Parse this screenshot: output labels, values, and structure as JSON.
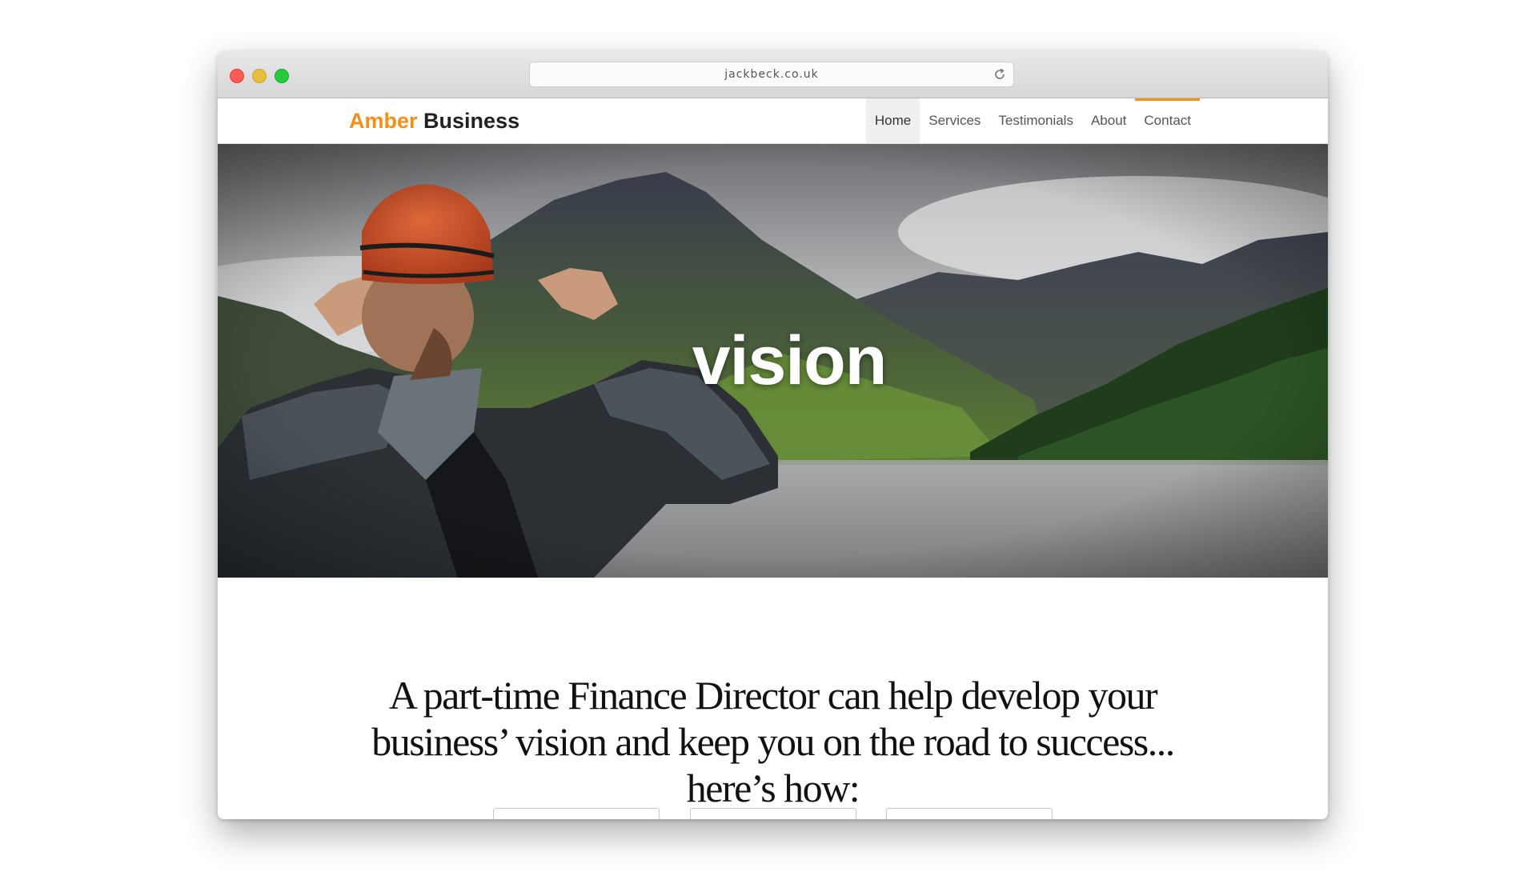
{
  "browser": {
    "url": "jackbeck.co.uk",
    "traffic_lights": [
      "close",
      "minimize",
      "zoom"
    ],
    "reload_icon": "reload-icon"
  },
  "site": {
    "logo_first": "Amber",
    "logo_second": "Business",
    "nav": [
      {
        "label": "Home"
      },
      {
        "label": "Services"
      },
      {
        "label": "Testimonials"
      },
      {
        "label": "About"
      },
      {
        "label": "Contact"
      }
    ]
  },
  "hero": {
    "word": "vision"
  },
  "main": {
    "headline_line1": "A part-time Finance Director can help develop your",
    "headline_line2": "business’ vision and keep you on the road to success...",
    "headline_line3": "here’s how:"
  },
  "colors": {
    "accent": "#f39019",
    "text": "#222222"
  }
}
